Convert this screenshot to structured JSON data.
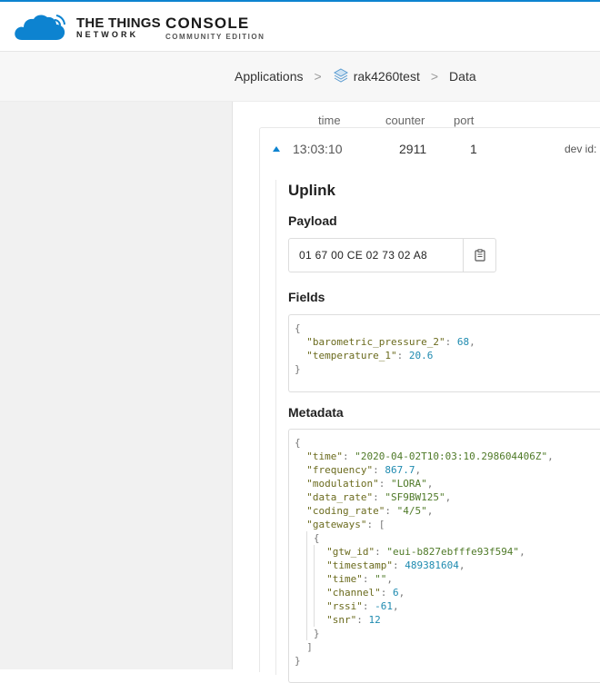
{
  "header": {
    "brand_line1": "THE THINGS",
    "brand_line2": "NETWORK",
    "console_line1": "CONSOLE",
    "console_line2": "COMMUNITY EDITION",
    "accent_color": "#0d83d0"
  },
  "breadcrumb": {
    "items": [
      {
        "label": "Applications",
        "icon": null
      },
      {
        "label": "rak4260test",
        "icon": "application-icon"
      },
      {
        "label": "Data",
        "icon": null
      }
    ],
    "separator": ">"
  },
  "table": {
    "columns": [
      "time",
      "counter",
      "port"
    ],
    "row": {
      "time": "13:03:10",
      "counter": "2911",
      "port": "1",
      "dev_id_label": "dev id:"
    }
  },
  "detail": {
    "title": "Uplink",
    "payload_label": "Payload",
    "payload_hex": "01 67 00 CE 02 73 02 A8",
    "fields_label": "Fields",
    "fields": [
      {
        "key": "\"barometric_pressure_2\"",
        "value": "68",
        "comma": ","
      },
      {
        "key": "\"temperature_1\"",
        "value": "20.6",
        "comma": ""
      }
    ],
    "metadata_label": "Metadata",
    "metadata": {
      "time": "\"2020-04-02T10:03:10.298604406Z\"",
      "frequency": "867.7",
      "modulation": "\"LORA\"",
      "data_rate": "\"SF9BW125\"",
      "coding_rate": "\"4/5\"",
      "gateways_key": "\"gateways\"",
      "gateway": {
        "gtw_id": "\"eui-b827ebfffe93f594\"",
        "timestamp": "489381604",
        "time": "\"\"",
        "channel": "6",
        "rssi": "-61",
        "snr": "12"
      }
    }
  }
}
